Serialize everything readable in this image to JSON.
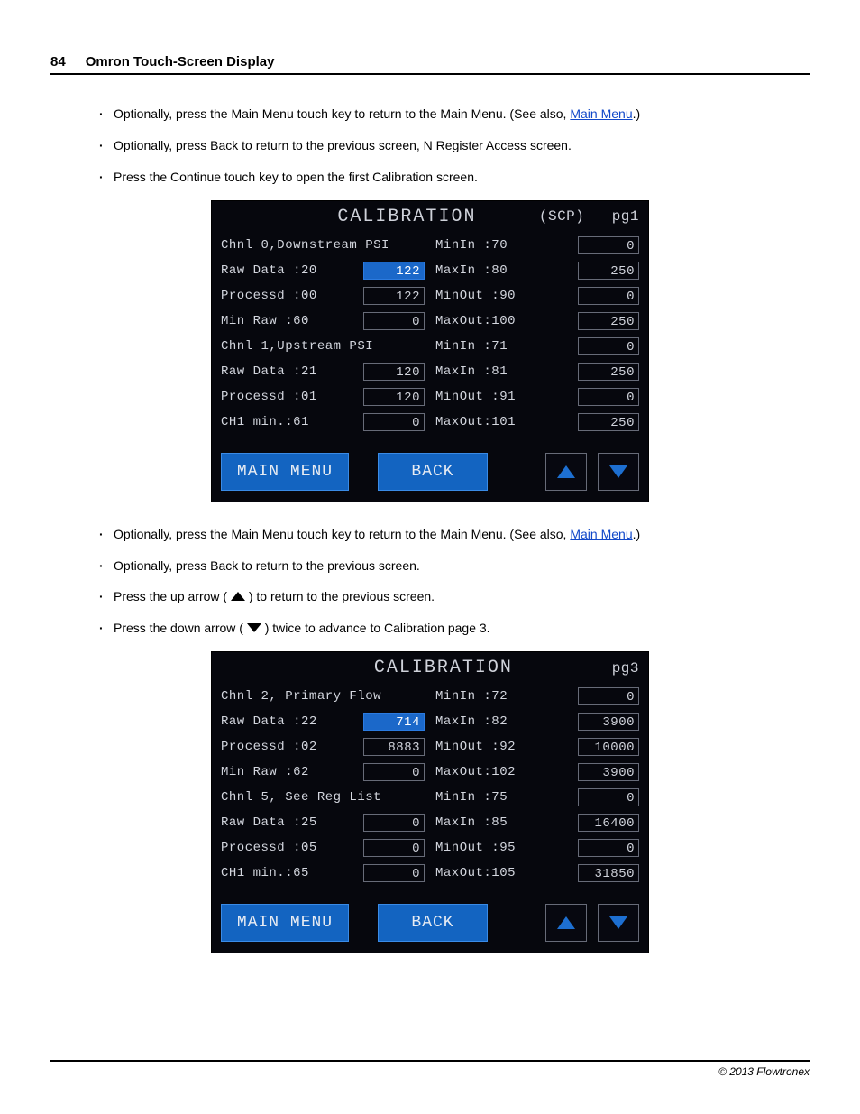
{
  "header": {
    "page_number": "84",
    "section": "Omron Touch-Screen Display"
  },
  "bullets_top": [
    {
      "pre": "Optionally, press the Main Menu touch key to return to the Main Menu. (See also, ",
      "link": "Main Menu",
      "post": ".)"
    },
    {
      "pre": "Optionally, press Back to return to the previous screen, N Register Access screen."
    },
    {
      "pre": "Press the Continue touch key to open the first Calibration screen."
    }
  ],
  "bullets_bottom": [
    {
      "pre": "Optionally, press the Main Menu touch key to return to the Main Menu. (See also, ",
      "link": "Main Menu",
      "post": ".)"
    },
    {
      "pre": "Optionally, press Back to return to the previous screen."
    },
    {
      "pre": "Press the up arrow ( ",
      "icon": "up",
      "post": " ) to return to the previous screen."
    },
    {
      "pre": "Press the down arrow ( ",
      "icon": "dn",
      "post": " ) twice to advance to Calibration page 3."
    }
  ],
  "screen1": {
    "title": "CALIBRATION",
    "title_sub": "(SCP)",
    "page": "pg1",
    "left": [
      {
        "label": "Chnl 0,Downstream PSI"
      },
      {
        "label": "Raw Data :20",
        "value": "122",
        "hl": true
      },
      {
        "label": "Processd :00",
        "value": "122"
      },
      {
        "label": "Min Raw :60",
        "value": "0"
      },
      {
        "label": "Chnl 1,Upstream PSI"
      },
      {
        "label": "Raw Data :21",
        "value": "120"
      },
      {
        "label": "Processd :01",
        "value": "120"
      },
      {
        "label": "CH1 min.:61",
        "value": "0"
      }
    ],
    "right": [
      {
        "label": "MinIn :70",
        "value": "0"
      },
      {
        "label": "MaxIn :80",
        "value": "250"
      },
      {
        "label": "MinOut :90",
        "value": "0"
      },
      {
        "label": "MaxOut:100",
        "value": "250"
      },
      {
        "label": "MinIn :71",
        "value": "0"
      },
      {
        "label": "MaxIn :81",
        "value": "250"
      },
      {
        "label": "MinOut :91",
        "value": "0"
      },
      {
        "label": "MaxOut:101",
        "value": "250"
      }
    ],
    "buttons": {
      "menu": "MAIN MENU",
      "back": "BACK"
    }
  },
  "screen2": {
    "title": "CALIBRATION",
    "title_sub": "",
    "page": "pg3",
    "left": [
      {
        "label": "Chnl 2, Primary Flow"
      },
      {
        "label": "Raw Data :22",
        "value": "714",
        "hl": true
      },
      {
        "label": "Processd :02",
        "value": "8883"
      },
      {
        "label": "Min Raw :62",
        "value": "0"
      },
      {
        "label": "Chnl 5, See Reg List"
      },
      {
        "label": "Raw Data :25",
        "value": "0"
      },
      {
        "label": "Processd :05",
        "value": "0"
      },
      {
        "label": "CH1 min.:65",
        "value": "0"
      }
    ],
    "right": [
      {
        "label": "MinIn :72",
        "value": "0"
      },
      {
        "label": "MaxIn :82",
        "value": "3900"
      },
      {
        "label": "MinOut :92",
        "value": "10000"
      },
      {
        "label": "MaxOut:102",
        "value": "3900"
      },
      {
        "label": "MinIn :75",
        "value": "0"
      },
      {
        "label": "MaxIn :85",
        "value": "16400"
      },
      {
        "label": "MinOut :95",
        "value": "0"
      },
      {
        "label": "MaxOut:105",
        "value": "31850"
      }
    ],
    "buttons": {
      "menu": "MAIN MENU",
      "back": "BACK"
    }
  },
  "footer": {
    "copyright": "© 2013 Flowtronex"
  }
}
